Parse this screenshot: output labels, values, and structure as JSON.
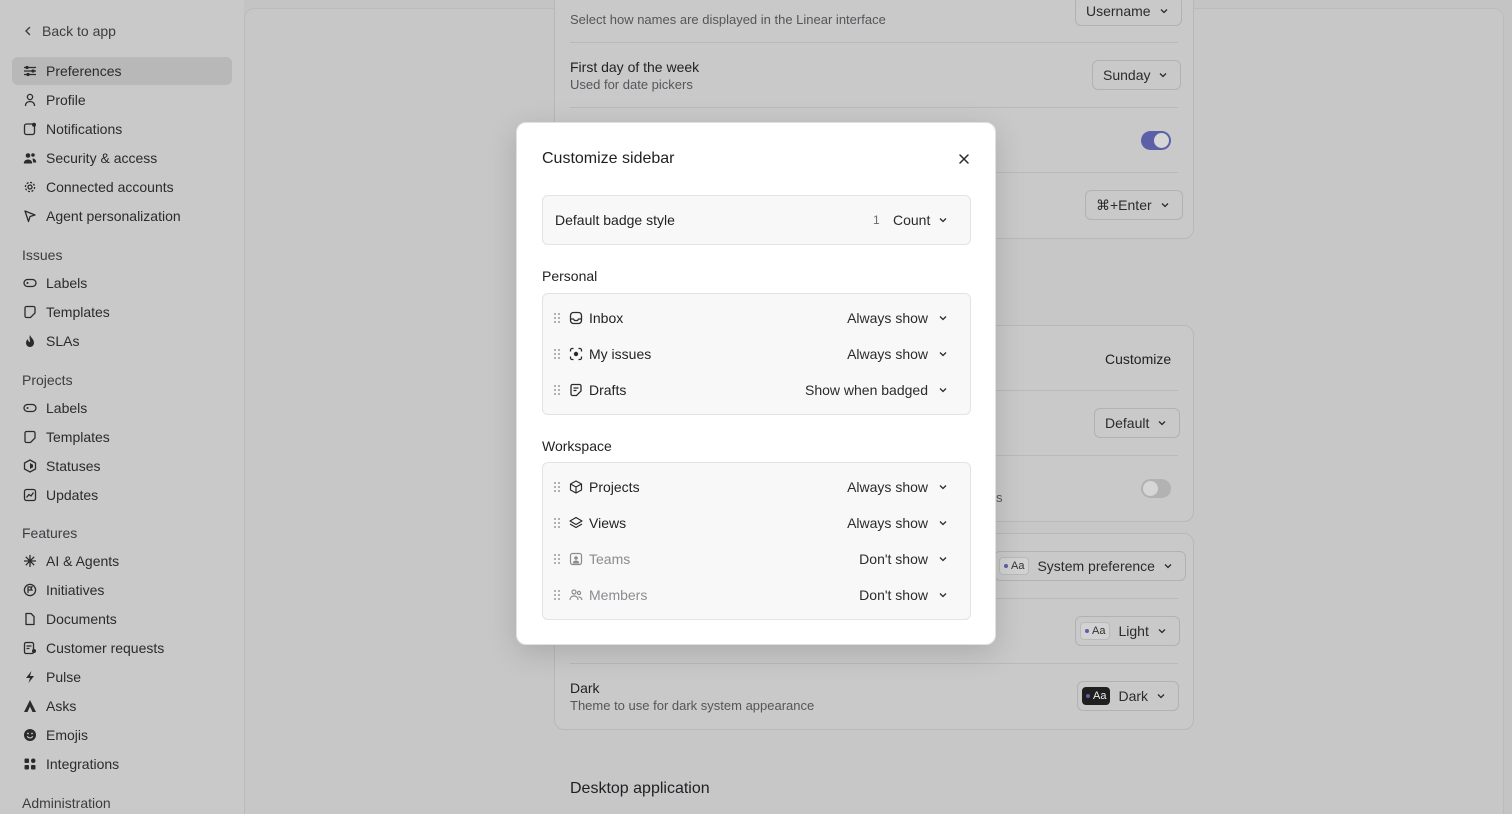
{
  "sidebar": {
    "back_label": "Back to app",
    "account_items": [
      {
        "label": "Preferences",
        "icon": "sliders-icon",
        "active": true
      },
      {
        "label": "Profile",
        "icon": "person-icon"
      },
      {
        "label": "Notifications",
        "icon": "notification-icon"
      },
      {
        "label": "Security & access",
        "icon": "people-icon"
      },
      {
        "label": "Connected accounts",
        "icon": "gear-icon"
      },
      {
        "label": "Agent personalization",
        "icon": "agent-icon"
      }
    ],
    "issues_label": "Issues",
    "issues_items": [
      {
        "label": "Labels",
        "icon": "label-icon"
      },
      {
        "label": "Templates",
        "icon": "template-icon"
      },
      {
        "label": "SLAs",
        "icon": "flame-icon"
      }
    ],
    "projects_label": "Projects",
    "projects_items": [
      {
        "label": "Labels",
        "icon": "label-icon"
      },
      {
        "label": "Templates",
        "icon": "template-icon"
      },
      {
        "label": "Statuses",
        "icon": "status-icon"
      },
      {
        "label": "Updates",
        "icon": "chart-icon"
      }
    ],
    "features_label": "Features",
    "features_items": [
      {
        "label": "AI & Agents",
        "icon": "sparkle-icon"
      },
      {
        "label": "Initiatives",
        "icon": "initiative-icon"
      },
      {
        "label": "Documents",
        "icon": "document-icon"
      },
      {
        "label": "Customer requests",
        "icon": "customer-icon"
      },
      {
        "label": "Pulse",
        "icon": "pulse-icon"
      },
      {
        "label": "Asks",
        "icon": "asks-icon"
      },
      {
        "label": "Emojis",
        "icon": "emoji-icon"
      },
      {
        "label": "Integrations",
        "icon": "integrations-icon"
      }
    ],
    "administration_label": "Administration"
  },
  "main": {
    "display_names_desc": "Select how names are displayed in the Linear interface",
    "display_names_value": "Username",
    "first_day_title": "First day of the week",
    "first_day_desc": "Used for date pickers",
    "first_day_value": "Sunday",
    "toggle1_on": true,
    "shortcut_value": "⌘+Enter",
    "customize_label": "Customize",
    "default_value": "Default",
    "partial_text_s": "s",
    "toggle2_on": false,
    "system_pref_value": "System preference",
    "aa_label": "Aa",
    "light_value": "Light",
    "dark_title": "Dark",
    "dark_desc": "Theme to use for dark system appearance",
    "dark_value": "Dark",
    "desktop_heading": "Desktop application"
  },
  "modal": {
    "title": "Customize sidebar",
    "badge_label": "Default badge style",
    "badge_number": "1",
    "badge_value": "Count",
    "personal_label": "Personal",
    "personal_items": [
      {
        "name": "Inbox",
        "value": "Always show",
        "icon": "inbox-icon"
      },
      {
        "name": "My issues",
        "value": "Always show",
        "icon": "my-issues-icon"
      },
      {
        "name": "Drafts",
        "value": "Show when badged",
        "icon": "drafts-icon"
      }
    ],
    "workspace_label": "Workspace",
    "workspace_items": [
      {
        "name": "Projects",
        "value": "Always show",
        "icon": "cube-icon"
      },
      {
        "name": "Views",
        "value": "Always show",
        "icon": "layers-icon"
      },
      {
        "name": "Teams",
        "value": "Don't show",
        "icon": "team-icon"
      },
      {
        "name": "Members",
        "value": "Don't show",
        "icon": "members-icon"
      }
    ]
  }
}
